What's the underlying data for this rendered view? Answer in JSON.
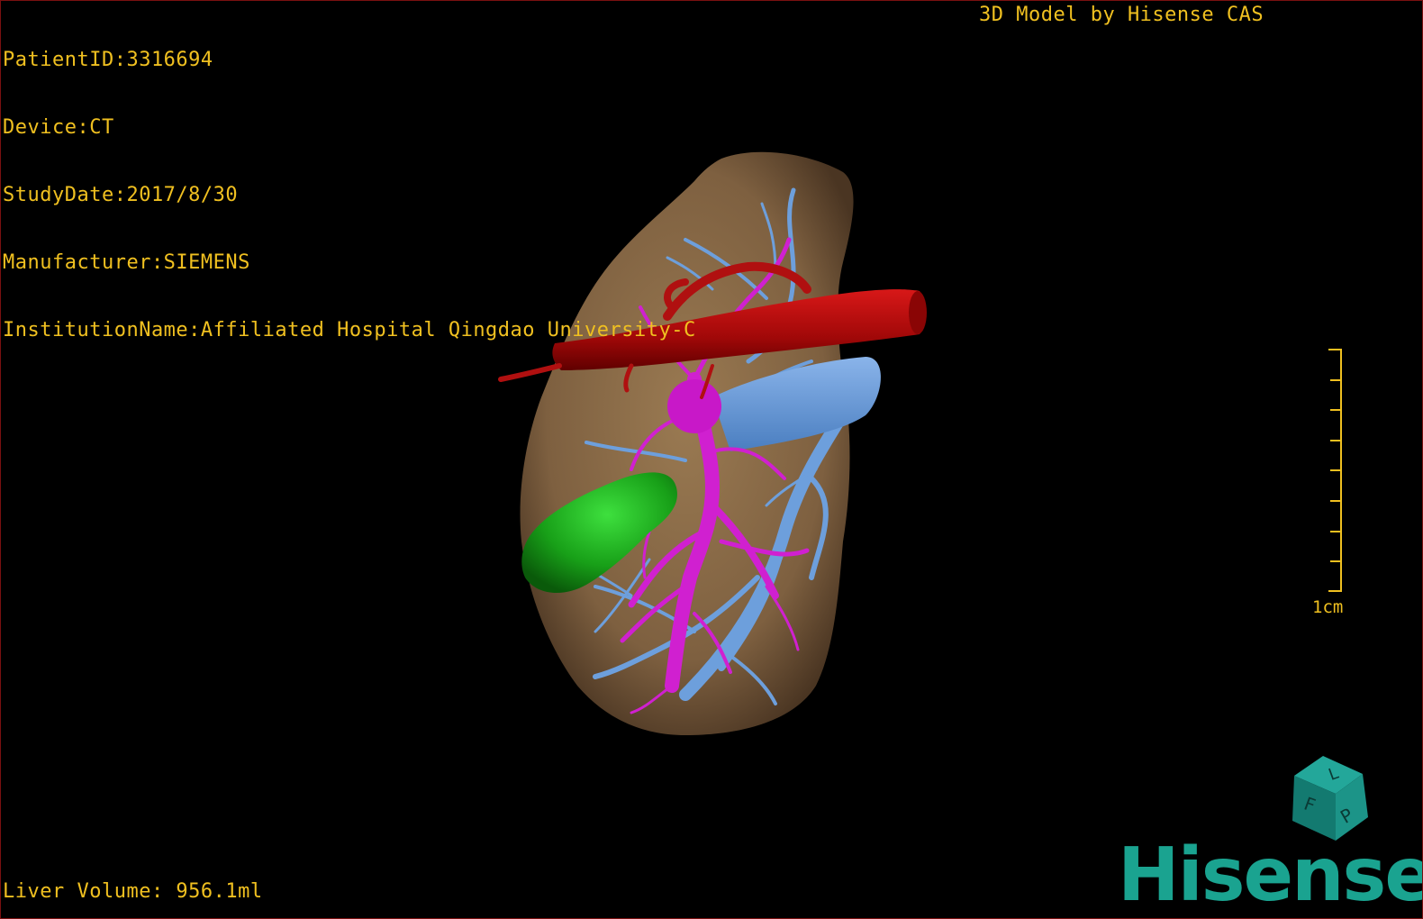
{
  "dicom": {
    "patient_id": "PatientID:3316694",
    "device": "Device:CT",
    "study_date": "StudyDate:2017/8/30",
    "manufacturer": "Manufacturer:SIEMENS",
    "institution": "InstitutionName:Affiliated Hospital Qingdao University-C"
  },
  "credit": "3D Model by Hisense CAS",
  "liver_volume": "Liver Volume: 956.1ml",
  "scale": {
    "label": "1cm",
    "color": "#f0c020"
  },
  "brand": {
    "name": "Hisense",
    "color": "#1aa390"
  },
  "orientation_cube": {
    "labels": [
      "F",
      "L",
      "P"
    ],
    "color": "#1a8a80"
  },
  "colors": {
    "liver": "#8a6a45",
    "hepatic_artery": "#c01010",
    "portal_vein": "#d020d0",
    "hepatic_vein": "#6d9fdc",
    "gallbladder": "#1fb01f",
    "overlay_text": "#f0c020"
  }
}
